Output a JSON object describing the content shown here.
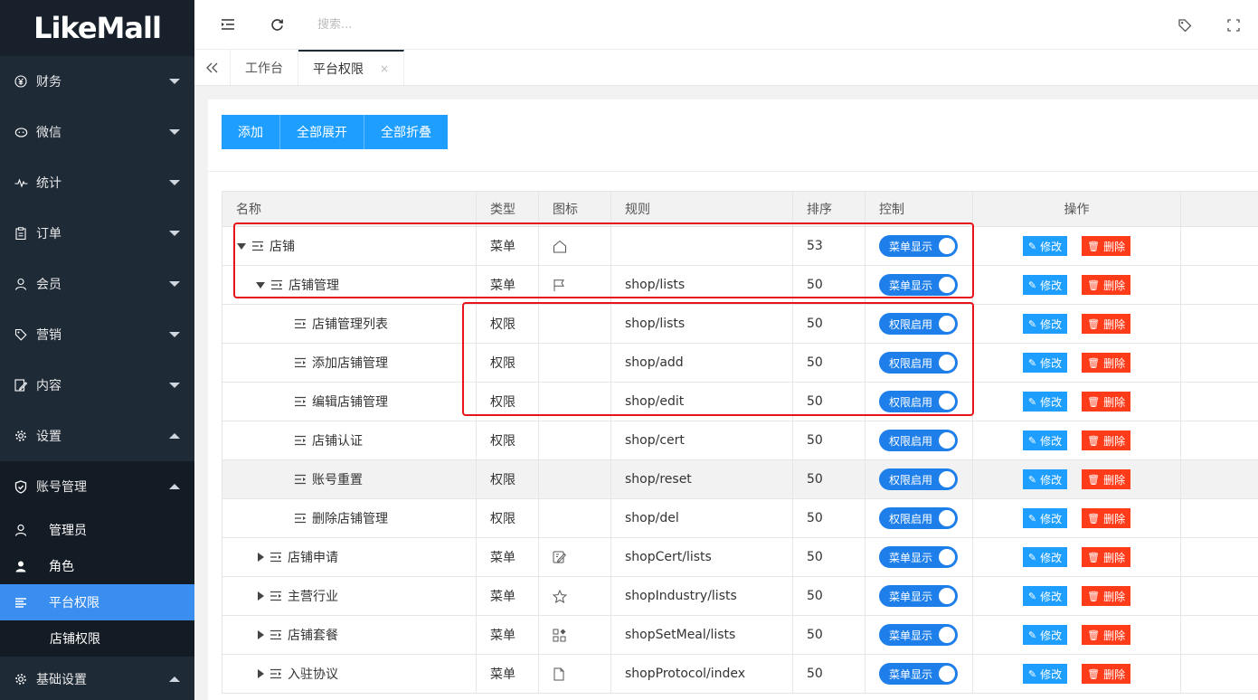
{
  "app": {
    "logo_text": "LikeMall"
  },
  "sidebar": {
    "items": [
      {
        "label": "财务",
        "icon": "yen-icon",
        "expanded": false
      },
      {
        "label": "微信",
        "icon": "wechat-icon",
        "expanded": false
      },
      {
        "label": "统计",
        "icon": "pulse-icon",
        "expanded": false
      },
      {
        "label": "订单",
        "icon": "clipboard-icon",
        "expanded": false
      },
      {
        "label": "会员",
        "icon": "user-icon",
        "expanded": false
      },
      {
        "label": "营销",
        "icon": "tag-icon",
        "expanded": false
      },
      {
        "label": "内容",
        "icon": "edit-doc-icon",
        "expanded": false
      },
      {
        "label": "设置",
        "icon": "gear-icon",
        "expanded": true
      }
    ],
    "account_group": {
      "label": "账号管理",
      "icon": "shield-icon",
      "children": [
        {
          "label": "管理员",
          "icon": "person-outline-icon"
        },
        {
          "label": "角色",
          "icon": "person-solid-icon"
        },
        {
          "label": "平台权限",
          "icon": "list-icon",
          "active": true
        },
        {
          "label": "店铺权限",
          "icon": ""
        }
      ]
    },
    "basic": {
      "label": "基础设置",
      "icon": "gear-icon"
    }
  },
  "topbar": {
    "search_placeholder": "搜索..."
  },
  "tabs": [
    {
      "label": "工作台"
    },
    {
      "label": "平台权限",
      "close": "×",
      "active": true
    }
  ],
  "actions": {
    "add": "添加",
    "expand_all": "全部展开",
    "collapse_all": "全部折叠"
  },
  "table": {
    "headers": {
      "name": "名称",
      "type": "类型",
      "icon": "图标",
      "rule": "规则",
      "sort": "排序",
      "control": "控制",
      "ops": "操作"
    },
    "edit_label": "修改",
    "delete_label": "删除",
    "rows": [
      {
        "name": "店铺",
        "level": 0,
        "toggle": "down",
        "type": "菜单",
        "icon": "home-icon",
        "rule": "",
        "sort": "53",
        "control": "菜单显示"
      },
      {
        "name": "店铺管理",
        "level": 1,
        "toggle": "down",
        "type": "菜单",
        "icon": "flag-icon",
        "rule": "shop/lists",
        "sort": "50",
        "control": "菜单显示"
      },
      {
        "name": "店铺管理列表",
        "level": 2,
        "toggle": "",
        "type": "权限",
        "icon": "",
        "rule": "shop/lists",
        "sort": "50",
        "control": "权限启用"
      },
      {
        "name": "添加店铺管理",
        "level": 2,
        "toggle": "",
        "type": "权限",
        "icon": "",
        "rule": "shop/add",
        "sort": "50",
        "control": "权限启用"
      },
      {
        "name": "编辑店铺管理",
        "level": 2,
        "toggle": "",
        "type": "权限",
        "icon": "",
        "rule": "shop/edit",
        "sort": "50",
        "control": "权限启用"
      },
      {
        "name": "店铺认证",
        "level": 2,
        "toggle": "",
        "type": "权限",
        "icon": "",
        "rule": "shop/cert",
        "sort": "50",
        "control": "权限启用"
      },
      {
        "name": "账号重置",
        "level": 2,
        "toggle": "",
        "type": "权限",
        "icon": "",
        "rule": "shop/reset",
        "sort": "50",
        "control": "权限启用",
        "highlight": true
      },
      {
        "name": "删除店铺管理",
        "level": 2,
        "toggle": "",
        "type": "权限",
        "icon": "",
        "rule": "shop/del",
        "sort": "50",
        "control": "权限启用"
      },
      {
        "name": "店铺申请",
        "level": 1,
        "toggle": "right",
        "type": "菜单",
        "icon": "edit-icon",
        "rule": "shopCert/lists",
        "sort": "50",
        "control": "菜单显示"
      },
      {
        "name": "主营行业",
        "level": 1,
        "toggle": "right",
        "type": "菜单",
        "icon": "star-icon",
        "rule": "shopIndustry/lists",
        "sort": "50",
        "control": "菜单显示"
      },
      {
        "name": "店铺套餐",
        "level": 1,
        "toggle": "right",
        "type": "菜单",
        "icon": "apps-icon",
        "rule": "shopSetMeal/lists",
        "sort": "50",
        "control": "菜单显示"
      },
      {
        "name": "入驻协议",
        "level": 1,
        "toggle": "right",
        "type": "菜单",
        "icon": "file-icon",
        "rule": "shopProtocol/index",
        "sort": "50",
        "control": "菜单显示"
      }
    ]
  }
}
